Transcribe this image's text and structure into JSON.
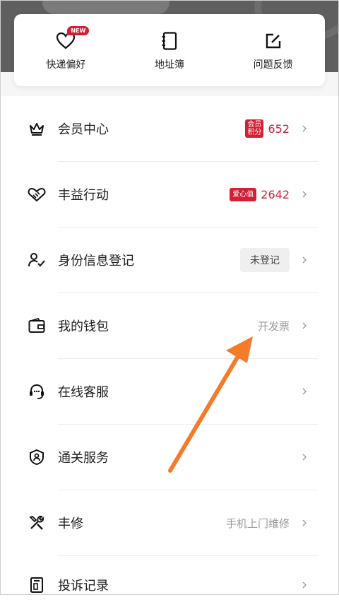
{
  "quick": [
    {
      "label": "快递偏好",
      "icon": "heart-icon",
      "badge": "NEW"
    },
    {
      "label": "地址簿",
      "icon": "notebook-icon"
    },
    {
      "label": "问题反馈",
      "icon": "edit-icon"
    }
  ],
  "rows": {
    "member": {
      "label": "会员中心",
      "badge_top": "会员",
      "badge_bottom": "积分",
      "value": "652"
    },
    "charity": {
      "label": "丰益行动",
      "badge": "爱心值",
      "value": "2642"
    },
    "identity": {
      "label": "身份信息登记",
      "status": "未登记"
    },
    "wallet": {
      "label": "我的钱包",
      "hint": "开发票"
    },
    "service": {
      "label": "在线客服"
    },
    "customs": {
      "label": "通关服务"
    },
    "repair": {
      "label": "丰修",
      "hint": "手机上门维修"
    },
    "complaint": {
      "label": "投诉记录"
    }
  },
  "colors": {
    "accent": "#d61f35",
    "arrow": "#f47b2a"
  }
}
